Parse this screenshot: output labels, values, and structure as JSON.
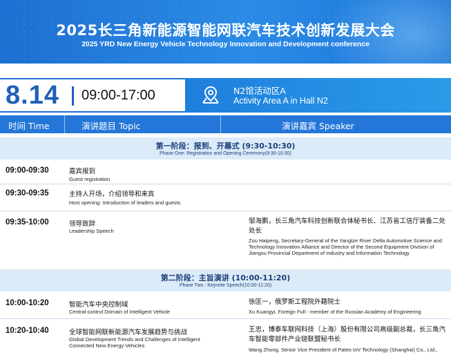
{
  "header": {
    "title_cn": "2025长三角新能源智能网联汽车技术创新发展大会",
    "title_en": "2025 YRD New Energy Vehicle Technology Innovation and Development conference"
  },
  "event": {
    "date": "8.14",
    "time": "09:00-17:00",
    "location_cn": "N2馆活动区A",
    "location_en": "Activity Area A in Hall N2",
    "location_icon": "map-pin-icon"
  },
  "table": {
    "col_time": "时间 Time",
    "col_topic": "演讲题目 Topic",
    "col_speaker": "演讲嘉宾 Speaker"
  },
  "phases": [
    {
      "cn": "第一阶段：报到、开幕式 (9:30-10:30)",
      "en": "Phase One: Registration and Opening Ceremony(9:30-10:30)"
    },
    {
      "cn": "第二阶段：主旨演讲 (10:00-11:20)",
      "en": "Phase Two : Keynote Speech(10:00-11:20)"
    }
  ],
  "rows": [
    {
      "time": "09:00-09:30",
      "topic_cn": "嘉宾报到",
      "topic_en": "Guest registration",
      "speaker_cn": "",
      "speaker_en": ""
    },
    {
      "time": "09:30-09:35",
      "topic_cn": "主持人开场，介绍领导和来宾",
      "topic_en": "Host opening: Introduction of leaders and guests",
      "speaker_cn": "",
      "speaker_en": ""
    },
    {
      "time": "09:35-10:00",
      "topic_cn": "领导致辞",
      "topic_en": "Leadership Speech",
      "speaker_cn": "邹海鹏，长三角汽车科技创新联合体秘书长、江苏省工信厅装备二处处长",
      "speaker_en": "Zou Haipeng, Secretary-General of the Yangtze River Delta Automotive Science and Technology Innovation Alliance and Director of the Second Equipment Division of Jiangsu Provincial Department of Industry and Information Technology"
    },
    {
      "time": "10:00-10:20",
      "topic_cn": "智能汽车中央控制域",
      "topic_en": "Central-control Domain of Intelligent Vehicle",
      "speaker_cn": "徐匡一，俄罗斯工程院外籍院士",
      "speaker_en": "Xu Kuangyi, Foreign Full - member of the Russian Academy of Engineering"
    },
    {
      "time": "10:20-10:40",
      "topic_cn": "全球智能网联新能源汽车发展趋势与挑战",
      "topic_en": "Global Development Trends and Challenges of Intelligent Connected New Energy Vehicles",
      "speaker_cn": "王忠，博泰车联网科技（上海）股份有限公司高级副总裁，长三角汽车智能零部件产业链联盟秘书长",
      "speaker_en": "Wang Zhong, Senior Vice President of Pateo IoV Technology (Shanghai) Co., Ltd.,"
    }
  ],
  "colors": {
    "header_blue": "#1d6fd1",
    "table_head": "#2477d8",
    "phase_bg": "#dcebf8",
    "date_blue": "#1f5fb8"
  }
}
